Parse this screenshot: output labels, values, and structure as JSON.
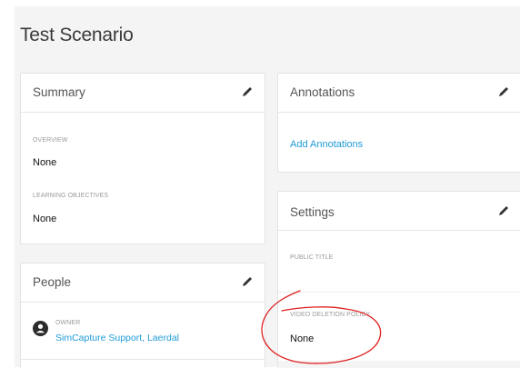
{
  "page": {
    "title": "Test Scenario"
  },
  "summary": {
    "title": "Summary",
    "overview_label": "OVERVIEW",
    "overview_value": "None",
    "objectives_label": "LEARNING OBJECTIVES",
    "objectives_value": "None"
  },
  "people": {
    "title": "People",
    "owner_label": "OWNER",
    "owner_name": "SimCapture Support, Laerdal"
  },
  "annotations": {
    "title": "Annotations",
    "add_link": "Add Annotations"
  },
  "settings": {
    "title": "Settings",
    "public_title_label": "PUBLIC TITLE",
    "video_policy_label": "VIDEO DELETION POLICY",
    "video_policy_value": "None"
  },
  "colors": {
    "link": "#1e9bd7",
    "annotation": "#e02020"
  },
  "icons": {
    "edit": "pencil-icon",
    "avatar": "person-icon"
  }
}
